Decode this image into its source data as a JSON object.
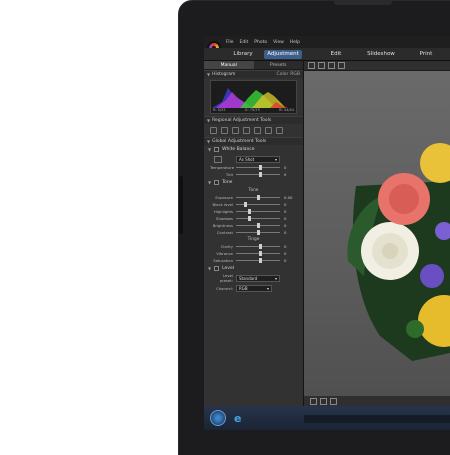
{
  "menu": {
    "items": [
      "File",
      "Edit",
      "Photo",
      "View",
      "Help"
    ]
  },
  "modes": {
    "library": "Library",
    "adjustment": "Adjustment",
    "edit": "Edit",
    "slideshow": "Slideshow",
    "print": "Print"
  },
  "panel": {
    "tabs": {
      "manual": "Manual",
      "presets": "Presets"
    },
    "histogram": {
      "title": "Histogram",
      "color_label": "Color",
      "mode": "RGB",
      "values": [
        "R: 0/33",
        "G: 75/75",
        "B: 44/44"
      ]
    },
    "regional": {
      "title": "Regional Adjustment Tools"
    },
    "global": {
      "title": "Global Adjustment Tools"
    },
    "white_balance": {
      "title": "White Balance",
      "preset": "As Shot",
      "rows": [
        {
          "label": "Temperature",
          "value": "0",
          "pos": 0.55
        },
        {
          "label": "Tint",
          "value": "0",
          "pos": 0.55
        }
      ]
    },
    "tone": {
      "title": "Tone",
      "group": "Tone",
      "rows": [
        {
          "label": "Exposure",
          "value": "0.00",
          "pos": 0.5
        },
        {
          "label": "Black level",
          "value": "0",
          "pos": 0.2
        },
        {
          "label": "Highlights",
          "value": "0",
          "pos": 0.3
        },
        {
          "label": "Shadows",
          "value": "0",
          "pos": 0.3
        },
        {
          "label": "Brightness",
          "value": "0",
          "pos": 0.5
        },
        {
          "label": "Contrast",
          "value": "0",
          "pos": 0.5
        }
      ]
    },
    "tinge": {
      "group": "Tinge",
      "rows": [
        {
          "label": "Clarity",
          "value": "0",
          "pos": 0.55
        },
        {
          "label": "Vibrance",
          "value": "0",
          "pos": 0.55
        },
        {
          "label": "Saturation",
          "value": "0",
          "pos": 0.55
        }
      ]
    },
    "level": {
      "title": "Level",
      "preset_label": "Level preset:",
      "preset": "Standard",
      "channel_label": "Channel:",
      "channel": "RGB"
    },
    "buttons": {
      "copy": "Copy...",
      "paste": "Paste",
      "reset": "Reset",
      "create": "Create..."
    }
  }
}
